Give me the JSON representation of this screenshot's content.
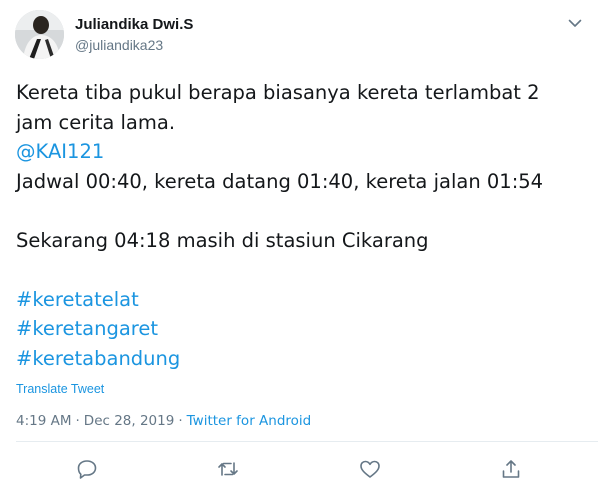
{
  "author": {
    "display_name": "Juliandika Dwi.S",
    "handle": "@juliandika23"
  },
  "tweet": {
    "line1": "Kereta tiba pukul berapa biasanya kereta terlambat 2",
    "line2": "jam cerita lama.",
    "mention": "@KAI121",
    "line4": "Jadwal 00:40, kereta datang 01:40, kereta jalan 01:54",
    "line5": "Sekarang 04:18 masih di stasiun Cikarang",
    "hashtags": [
      "#keretatelat",
      "#keretangaret",
      "#keretabandung"
    ]
  },
  "translate_label": "Translate Tweet",
  "meta": {
    "time": "4:19 AM",
    "date": "Dec 28, 2019",
    "separator": "·",
    "source": "Twitter for Android"
  },
  "colors": {
    "link": "#1b95e0",
    "secondary_text": "#657786",
    "primary_text": "#14171a"
  },
  "icons": {
    "menu": "chevron-down-icon",
    "reply": "reply-icon",
    "retweet": "retweet-icon",
    "like": "heart-icon",
    "share": "share-icon"
  }
}
